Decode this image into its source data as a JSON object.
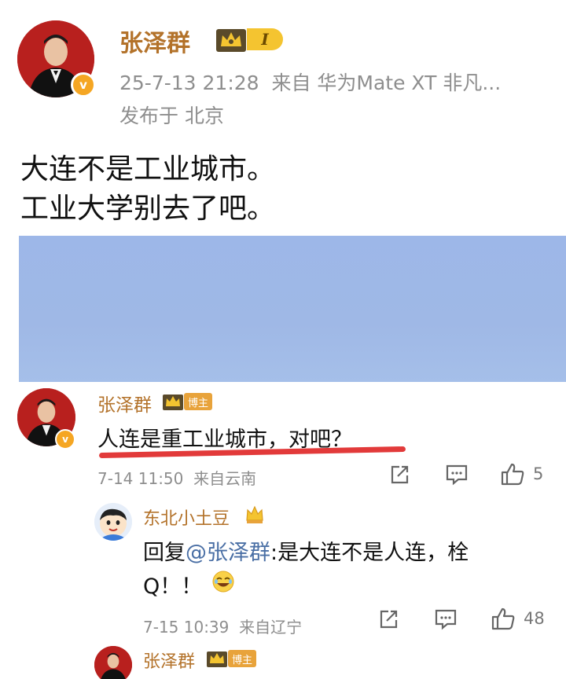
{
  "post": {
    "author": "张泽群",
    "level": "I",
    "meta_line": "25-7-13 21:28  来自 华为Mate XT 非凡...",
    "location_line": "发布于 北京",
    "text_line1": "大连不是工业城市。",
    "text_line2": "工业大学别去了吧。"
  },
  "comment1": {
    "author": "张泽群",
    "host_label": "博主",
    "text": "人连是重工业城市，对吧？",
    "meta": "7-14 11:50  来自云南",
    "likes": "5"
  },
  "reply1": {
    "author": "东北小土豆",
    "reply_prefix": "回复",
    "mention": "@张泽群",
    "text_line1": ":是大连不是人连，栓",
    "text_line2": "Q！！",
    "meta": "7-15 10:39  来自辽宁",
    "likes": "48"
  },
  "comment2": {
    "author": "张泽群",
    "host_label": "博主"
  },
  "colors": {
    "name": "#b3722a",
    "meta": "#8e8e8e",
    "underline": "#e23a3a",
    "image_placeholder": "#9fb8e6"
  }
}
